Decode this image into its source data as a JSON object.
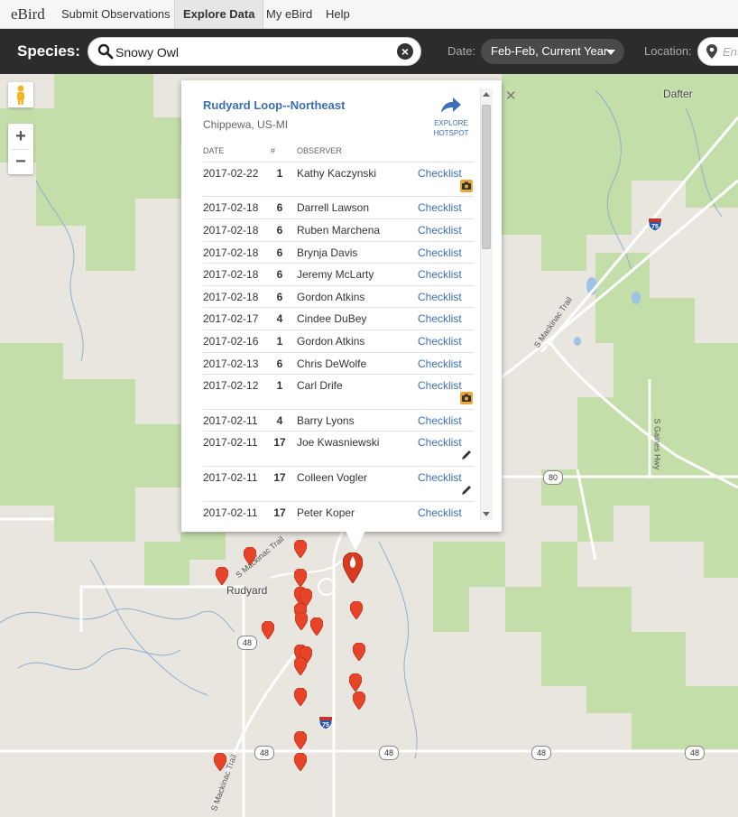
{
  "nav": {
    "logo": "eBird",
    "items": [
      {
        "label": "Submit Observations"
      },
      {
        "label": "Explore Data"
      },
      {
        "label": "My eBird"
      },
      {
        "label": "Help"
      }
    ]
  },
  "search": {
    "species_label": "Species:",
    "species_value": "Snowy Owl",
    "date_label": "Date:",
    "date_value": "Feb-Feb, Current Year",
    "location_label": "Location:",
    "location_placeholder": "Ent"
  },
  "map": {
    "places": [
      "Dafter",
      "Rudyard"
    ],
    "roads": [
      "S Mackinac Trail",
      "S Mackinac Trail",
      "S Gaines Hwy",
      "S Mackinac Trail"
    ],
    "shields": [
      "80",
      "48",
      "48",
      "48",
      "48",
      "48"
    ],
    "interstate": "75",
    "colors": {
      "marker": "#e8442a",
      "forest": "#c4deaa",
      "land": "#e9e6df"
    }
  },
  "popup": {
    "title": "Rudyard Loop--Northeast",
    "subtitle": "Chippewa, US-MI",
    "explore": "EXPLORE HOTSPOT",
    "close": "✕",
    "headers": {
      "date": "DATE",
      "count": "#",
      "observer": "OBSERVER"
    },
    "rows": [
      {
        "date": "2017-02-22",
        "count": "1",
        "observer": "Kathy Kaczynski",
        "link": "Checklist",
        "badge": "camera"
      },
      {
        "date": "2017-02-18",
        "count": "6",
        "observer": "Darrell Lawson",
        "link": "Checklist",
        "badge": ""
      },
      {
        "date": "2017-02-18",
        "count": "6",
        "observer": "Ruben Marchena",
        "link": "Checklist",
        "badge": ""
      },
      {
        "date": "2017-02-18",
        "count": "6",
        "observer": "Brynja Davis",
        "link": "Checklist",
        "badge": ""
      },
      {
        "date": "2017-02-18",
        "count": "6",
        "observer": "Jeremy McLarty",
        "link": "Checklist",
        "badge": ""
      },
      {
        "date": "2017-02-18",
        "count": "6",
        "observer": "Gordon Atkins",
        "link": "Checklist",
        "badge": ""
      },
      {
        "date": "2017-02-17",
        "count": "4",
        "observer": "Cindee DuBey",
        "link": "Checklist",
        "badge": ""
      },
      {
        "date": "2017-02-16",
        "count": "1",
        "observer": "Gordon Atkins",
        "link": "Checklist",
        "badge": ""
      },
      {
        "date": "2017-02-13",
        "count": "6",
        "observer": "Chris DeWolfe",
        "link": "Checklist",
        "badge": ""
      },
      {
        "date": "2017-02-12",
        "count": "1",
        "observer": "Carl Drife",
        "link": "Checklist",
        "badge": "camera"
      },
      {
        "date": "2017-02-11",
        "count": "4",
        "observer": "Barry Lyons",
        "link": "Checklist",
        "badge": ""
      },
      {
        "date": "2017-02-11",
        "count": "17",
        "observer": "Joe Kwasniewski",
        "link": "Checklist",
        "badge": "pencil"
      },
      {
        "date": "2017-02-11",
        "count": "17",
        "observer": "Colleen Vogler",
        "link": "Checklist",
        "badge": "pencil"
      },
      {
        "date": "2017-02-11",
        "count": "17",
        "observer": "Peter Koper",
        "link": "Checklist",
        "badge": ""
      }
    ]
  }
}
